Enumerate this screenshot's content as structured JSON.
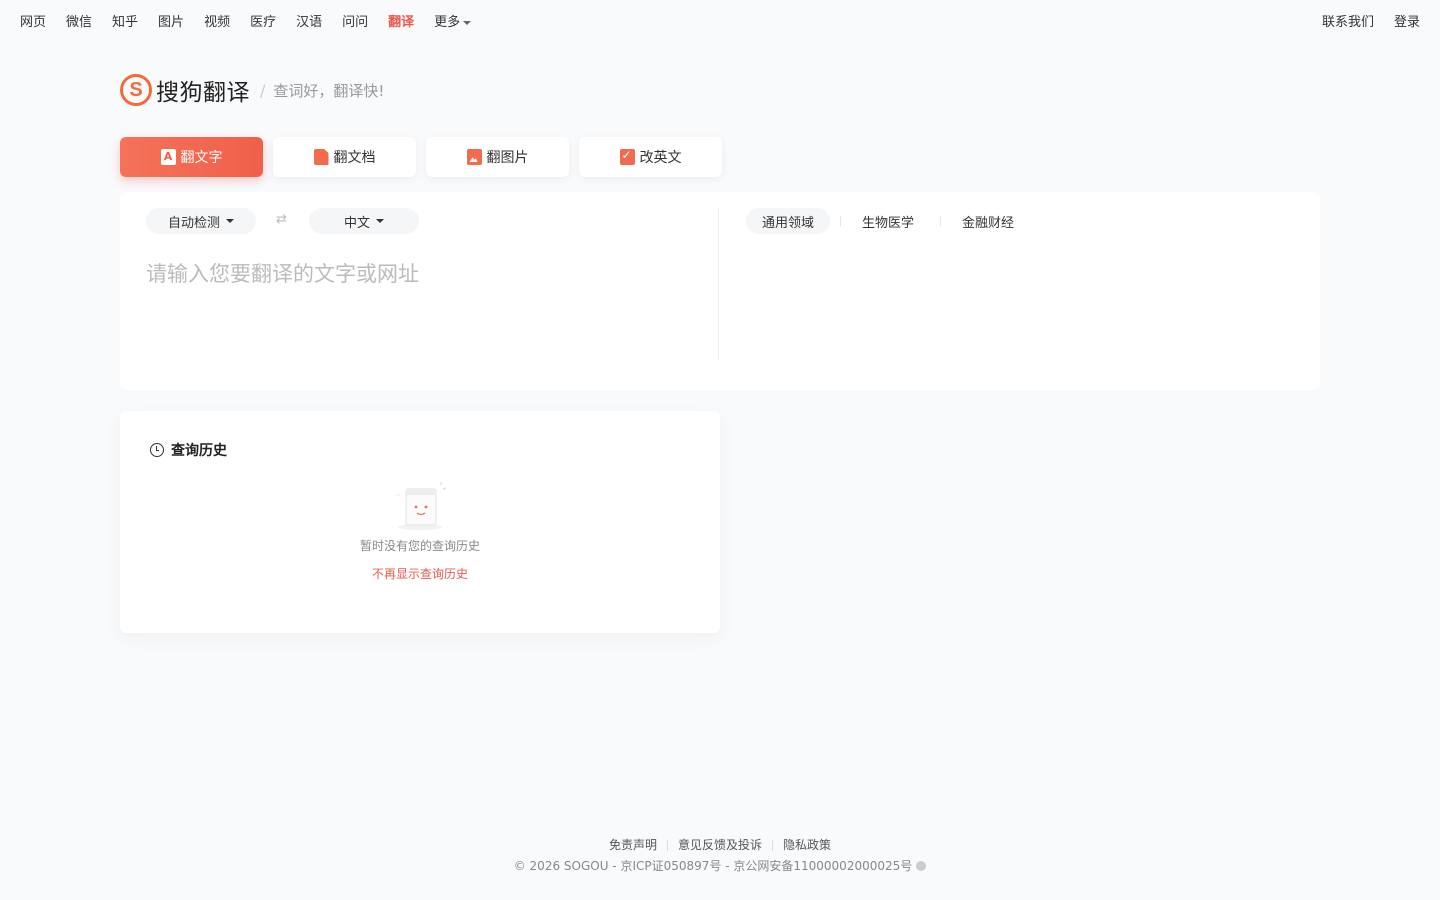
{
  "topnav": {
    "left": [
      {
        "label": "网页"
      },
      {
        "label": "微信"
      },
      {
        "label": "知乎"
      },
      {
        "label": "图片"
      },
      {
        "label": "视频"
      },
      {
        "label": "医疗"
      },
      {
        "label": "汉语"
      },
      {
        "label": "问问"
      },
      {
        "label": "翻译",
        "active": true
      }
    ],
    "more_label": "更多",
    "right": [
      {
        "label": "联系我们"
      },
      {
        "label": "登录"
      }
    ]
  },
  "brand": {
    "name": "搜狗翻译",
    "slogan": "查词好，翻译快!",
    "accent_color": "#f26b3a"
  },
  "tabs": [
    {
      "label": "翻文字",
      "icon": "text-a-icon",
      "active": true
    },
    {
      "label": "翻文档",
      "icon": "document-icon"
    },
    {
      "label": "翻图片",
      "icon": "image-icon"
    },
    {
      "label": "改英文",
      "icon": "edit-check-icon"
    }
  ],
  "translator": {
    "source_lang": "自动检测",
    "target_lang": "中文",
    "swap_icon": "swap-arrows-icon",
    "placeholder": "请输入您要翻译的文字或网址",
    "domains": [
      {
        "label": "通用领域",
        "active": true
      },
      {
        "label": "生物医学"
      },
      {
        "label": "金融财经"
      }
    ]
  },
  "history": {
    "title": "查询历史",
    "empty_text": "暂时没有您的查询历史",
    "hide_link": "不再显示查询历史"
  },
  "footer": {
    "links": [
      "免责声明",
      "意见反馈及投诉",
      "隐私政策"
    ],
    "copyright": "© 2026 SOGOU - 京ICP证050897号 - 京公网安备11000002000025号"
  },
  "colors": {
    "active_red": "#e85a4f",
    "tab_gradient_start": "#f5725a",
    "tab_gradient_end": "#f0604a"
  }
}
